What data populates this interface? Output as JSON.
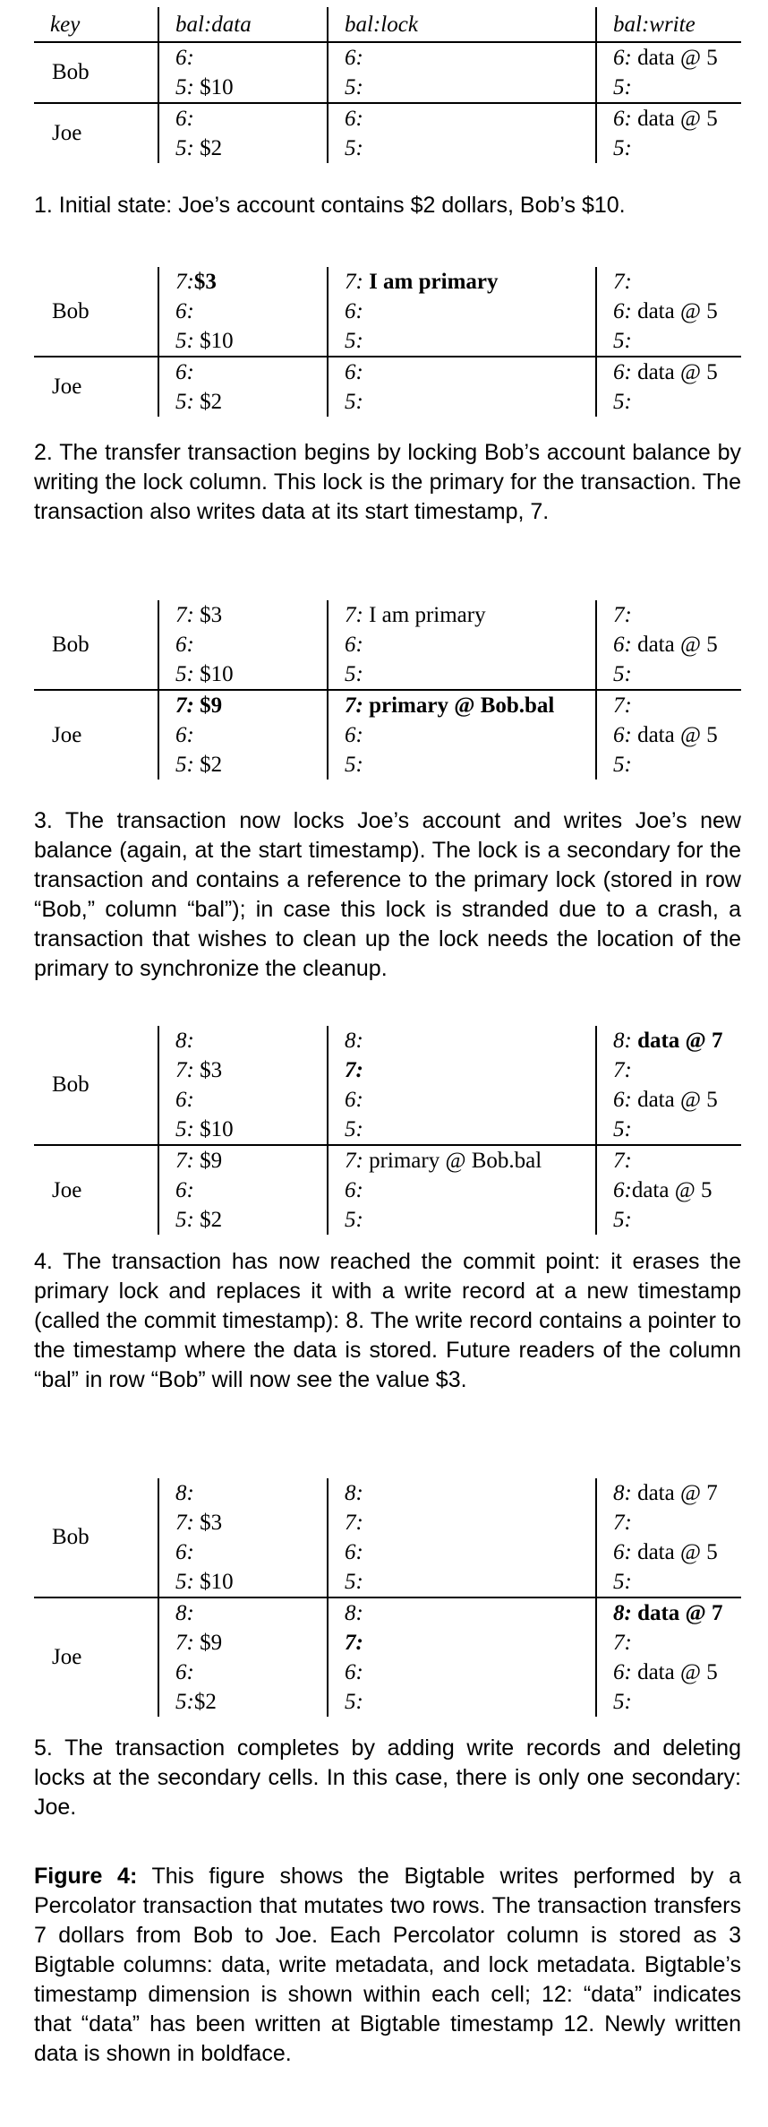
{
  "headers": [
    "key",
    "bal:data",
    "bal:lock",
    "bal:write"
  ],
  "figures": [
    {
      "rows": [
        {
          "key": "Bob",
          "data": [
            {
              "ts": "6:",
              "val": ""
            },
            {
              "ts": "5:",
              "val": " $10"
            }
          ],
          "lock": [
            {
              "ts": "6:",
              "val": ""
            },
            {
              "ts": "5:",
              "val": ""
            }
          ],
          "write": [
            {
              "ts": "6:",
              "val": " data @ 5"
            },
            {
              "ts": "5:",
              "val": ""
            }
          ]
        },
        {
          "key": "Joe",
          "data": [
            {
              "ts": "6:",
              "val": ""
            },
            {
              "ts": "5:",
              "val": " $2"
            }
          ],
          "lock": [
            {
              "ts": "6:",
              "val": ""
            },
            {
              "ts": "5:",
              "val": ""
            }
          ],
          "write": [
            {
              "ts": "6:",
              "val": " data @ 5"
            },
            {
              "ts": "5:",
              "val": ""
            }
          ]
        }
      ],
      "caption": "1. Initial state: Joe’s account contains $2 dollars, Bob’s $10."
    },
    {
      "rows": [
        {
          "key": "Bob",
          "data": [
            {
              "ts": "7:",
              "val": "$3",
              "bold": true
            },
            {
              "ts": "6:",
              "val": ""
            },
            {
              "ts": "5:",
              "val": " $10"
            }
          ],
          "lock": [
            {
              "ts": "7:",
              "val": " I am primary",
              "bold": true
            },
            {
              "ts": "6:",
              "val": ""
            },
            {
              "ts": "5:",
              "val": ""
            }
          ],
          "write": [
            {
              "ts": "7:",
              "val": ""
            },
            {
              "ts": "6:",
              "val": " data @ 5"
            },
            {
              "ts": "5:",
              "val": ""
            }
          ]
        },
        {
          "key": "Joe",
          "data": [
            {
              "ts": "6:",
              "val": ""
            },
            {
              "ts": "5:",
              "val": " $2"
            }
          ],
          "lock": [
            {
              "ts": "6:",
              "val": ""
            },
            {
              "ts": "5:",
              "val": ""
            }
          ],
          "write": [
            {
              "ts": "6:",
              "val": " data @ 5"
            },
            {
              "ts": "5:",
              "val": ""
            }
          ]
        }
      ],
      "caption": "2. The transfer transaction begins by locking Bob’s account balance by writing the lock column. This lock is the primary for the transaction. The transaction also writes data at its start timestamp, 7."
    },
    {
      "rows": [
        {
          "key": "Bob",
          "data": [
            {
              "ts": "7:",
              "val": " $3"
            },
            {
              "ts": "6:",
              "val": ""
            },
            {
              "ts": "5:",
              "val": " $10"
            }
          ],
          "lock": [
            {
              "ts": "7:",
              "val": " I am primary"
            },
            {
              "ts": "6:",
              "val": ""
            },
            {
              "ts": "5:",
              "val": ""
            }
          ],
          "write": [
            {
              "ts": "7:",
              "val": ""
            },
            {
              "ts": "6:",
              "val": " data @ 5"
            },
            {
              "ts": "5:",
              "val": ""
            }
          ]
        },
        {
          "key": "Joe",
          "data": [
            {
              "ts": "7:",
              "val": " $9",
              "bold": true,
              "boldTs": true
            },
            {
              "ts": "6:",
              "val": ""
            },
            {
              "ts": "5:",
              "val": " $2"
            }
          ],
          "lock": [
            {
              "ts": "7:",
              "val": " primary @ Bob.bal",
              "bold": true,
              "boldTs": true
            },
            {
              "ts": "6:",
              "val": ""
            },
            {
              "ts": "5:",
              "val": ""
            }
          ],
          "write": [
            {
              "ts": "7:",
              "val": ""
            },
            {
              "ts": "6:",
              "val": " data @ 5"
            },
            {
              "ts": "5:",
              "val": ""
            }
          ]
        }
      ],
      "caption": "3. The transaction now locks Joe’s account and writes Joe’s new balance (again, at the start timestamp). The lock is a secondary for the transaction and contains a reference to the primary lock (stored in row “Bob,” column “bal”); in case this lock is stranded due to a crash, a transaction that wishes to clean up the lock needs the location of the primary to synchronize the cleanup."
    },
    {
      "rows": [
        {
          "key": "Bob",
          "data": [
            {
              "ts": "8:",
              "val": ""
            },
            {
              "ts": "7:",
              "val": " $3"
            },
            {
              "ts": "6:",
              "val": ""
            },
            {
              "ts": "5:",
              "val": " $10"
            }
          ],
          "lock": [
            {
              "ts": "8:",
              "val": ""
            },
            {
              "ts": "7:",
              "val": "",
              "boldTs": true
            },
            {
              "ts": "6:",
              "val": ""
            },
            {
              "ts": "5:",
              "val": ""
            }
          ],
          "write": [
            {
              "ts": "8:",
              "val": " data @ 7",
              "bold": true
            },
            {
              "ts": "7:",
              "val": ""
            },
            {
              "ts": "6:",
              "val": " data @ 5"
            },
            {
              "ts": "5:",
              "val": ""
            }
          ]
        },
        {
          "key": "Joe",
          "data": [
            {
              "ts": "7:",
              "val": " $9"
            },
            {
              "ts": "6:",
              "val": ""
            },
            {
              "ts": "5:",
              "val": " $2"
            }
          ],
          "lock": [
            {
              "ts": "7:",
              "val": " primary @ Bob.bal"
            },
            {
              "ts": "6:",
              "val": ""
            },
            {
              "ts": "5:",
              "val": ""
            }
          ],
          "write": [
            {
              "ts": "7:",
              "val": ""
            },
            {
              "ts": "6:",
              "val": "data @ 5"
            },
            {
              "ts": "5:",
              "val": ""
            }
          ]
        }
      ],
      "caption": "4. The transaction has now reached the commit point: it erases the primary lock and replaces it with a write record at a new timestamp (called the commit timestamp): 8. The write record contains a pointer to the timestamp where the data is stored. Future readers of the column “bal” in row “Bob” will now see the value $3."
    },
    {
      "rows": [
        {
          "key": "Bob",
          "data": [
            {
              "ts": "8:",
              "val": ""
            },
            {
              "ts": "7:",
              "val": " $3"
            },
            {
              "ts": "6:",
              "val": ""
            },
            {
              "ts": "5:",
              "val": " $10"
            }
          ],
          "lock": [
            {
              "ts": "8:",
              "val": ""
            },
            {
              "ts": "7:",
              "val": ""
            },
            {
              "ts": "6:",
              "val": ""
            },
            {
              "ts": "5:",
              "val": ""
            }
          ],
          "write": [
            {
              "ts": "8:",
              "val": " data @ 7"
            },
            {
              "ts": "7:",
              "val": ""
            },
            {
              "ts": "6:",
              "val": " data @ 5"
            },
            {
              "ts": "5:",
              "val": ""
            }
          ]
        },
        {
          "key": "Joe",
          "data": [
            {
              "ts": "8:",
              "val": ""
            },
            {
              "ts": "7:",
              "val": " $9"
            },
            {
              "ts": "6:",
              "val": ""
            },
            {
              "ts": "5:",
              "val": "$2"
            }
          ],
          "lock": [
            {
              "ts": "8:",
              "val": ""
            },
            {
              "ts": "7:",
              "val": "",
              "boldTs": true
            },
            {
              "ts": "6:",
              "val": ""
            },
            {
              "ts": "5:",
              "val": ""
            }
          ],
          "write": [
            {
              "ts": "8:",
              "val": " data @ 7",
              "bold": true,
              "boldTs": true
            },
            {
              "ts": "7:",
              "val": ""
            },
            {
              "ts": "6:",
              "val": " data @ 5"
            },
            {
              "ts": "5:",
              "val": ""
            }
          ]
        }
      ],
      "caption": "5. The transaction completes by adding write records and deleting locks at the secondary cells. In this case, there is only one secondary: Joe."
    }
  ],
  "figure_caption": {
    "label": "Figure 4:",
    "text": " This figure shows the Bigtable writes performed by a Percolator transaction that mutates two rows. The transaction transfers 7 dollars from Bob to Joe. Each Percolator column is stored as 3 Bigtable columns: data, write metadata, and lock metadata. Bigtable’s timestamp dimension is shown within each cell; 12: “data” indicates that “data” has been written at Bigtable timestamp 12. Newly written data is shown in boldface."
  }
}
